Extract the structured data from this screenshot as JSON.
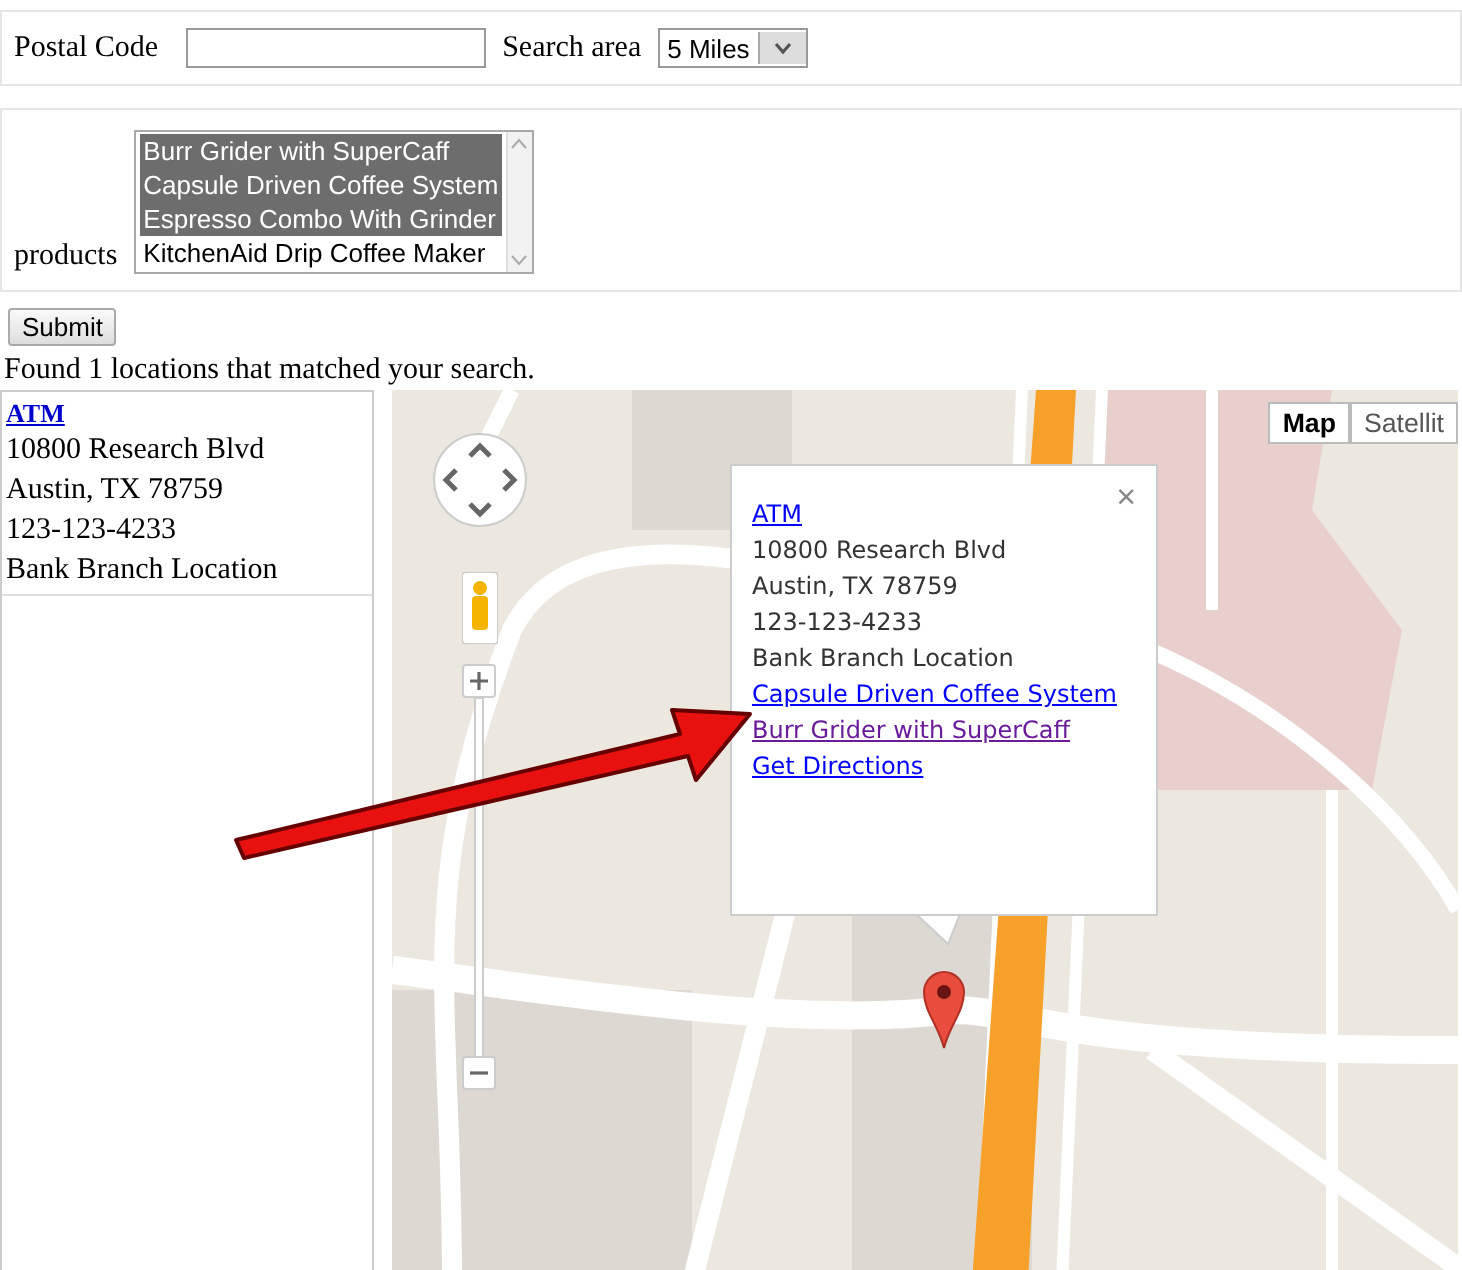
{
  "search_form": {
    "postal_label": "Postal Code",
    "area_label": "Search area",
    "area_value": "5 Miles"
  },
  "products": {
    "label": "products",
    "options": [
      {
        "label": "Burr Grider with SuperCaff",
        "selected": true
      },
      {
        "label": "Capsule Driven Coffee System",
        "selected": true
      },
      {
        "label": "Espresso Combo With Grinder",
        "selected": true
      },
      {
        "label": "KitchenAid Drip Coffee Maker",
        "selected": false
      }
    ]
  },
  "submit": "Submit",
  "result_text": "Found 1 locations that matched your search.",
  "locations": [
    {
      "name": "ATM",
      "lines": [
        "10800 Research Blvd",
        "Austin, TX 78759",
        "123-123-4233",
        "Bank Branch Location"
      ]
    }
  ],
  "map": {
    "type_buttons": [
      {
        "label": "Map",
        "selected": true
      },
      {
        "label": "Satellit",
        "selected": false
      }
    ],
    "info_window": {
      "title": "ATM",
      "close": "×",
      "lines": [
        "10800 Research Blvd",
        "Austin, TX 78759",
        "123-123-4233",
        "Bank Branch Location"
      ],
      "links": [
        {
          "label": "Capsule Driven Coffee System",
          "visited": false
        },
        {
          "label": "Burr Grider with SuperCaff",
          "visited": true
        },
        {
          "label": "Get Directions",
          "visited": false
        }
      ]
    }
  }
}
